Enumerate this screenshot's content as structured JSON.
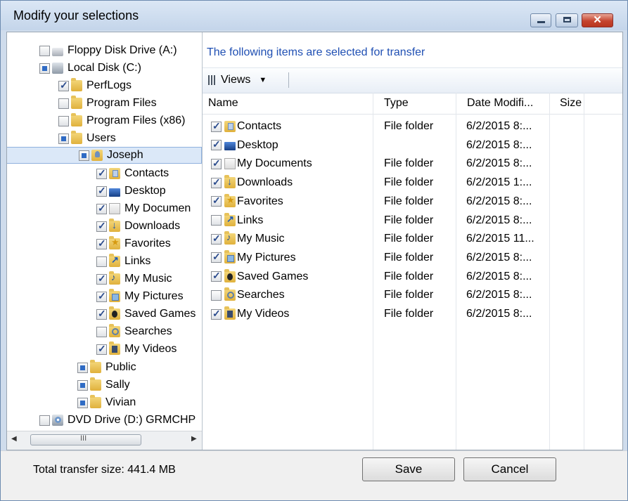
{
  "window": {
    "title": "Modify your selections",
    "close_glyph": "✕"
  },
  "tree": {
    "nodes": [
      {
        "label": "Floppy Disk Drive (A:)",
        "icon": "floppy-drive-icon",
        "check": "unchecked"
      },
      {
        "label": "Local Disk (C:)",
        "icon": "local-disk-icon",
        "check": "partial"
      },
      {
        "label": "PerfLogs",
        "icon": "folder-icon",
        "check": "checked"
      },
      {
        "label": "Program Files",
        "icon": "folder-icon",
        "check": "unchecked"
      },
      {
        "label": "Program Files (x86)",
        "icon": "folder-icon",
        "check": "unchecked"
      },
      {
        "label": "Users",
        "icon": "folder-icon",
        "check": "partial"
      },
      {
        "label": "Joseph",
        "icon": "user-folder-icon",
        "check": "partial",
        "selected": true
      },
      {
        "label": "Contacts",
        "icon": "contacts-folder-icon",
        "check": "checked"
      },
      {
        "label": "Desktop",
        "icon": "desktop-icon",
        "check": "checked"
      },
      {
        "label": "My Documen",
        "icon": "documents-folder-icon",
        "check": "checked"
      },
      {
        "label": "Downloads",
        "icon": "downloads-folder-icon",
        "check": "checked"
      },
      {
        "label": "Favorites",
        "icon": "favorites-folder-icon",
        "check": "checked"
      },
      {
        "label": "Links",
        "icon": "links-folder-icon",
        "check": "unchecked"
      },
      {
        "label": "My Music",
        "icon": "music-folder-icon",
        "check": "checked"
      },
      {
        "label": "My Pictures",
        "icon": "pictures-folder-icon",
        "check": "checked"
      },
      {
        "label": "Saved Games",
        "icon": "saved-games-folder-icon",
        "check": "checked"
      },
      {
        "label": "Searches",
        "icon": "searches-folder-icon",
        "check": "unchecked"
      },
      {
        "label": "My Videos",
        "icon": "videos-folder-icon",
        "check": "checked"
      },
      {
        "label": "Public",
        "icon": "folder-icon",
        "check": "partial"
      },
      {
        "label": "Sally",
        "icon": "folder-icon",
        "check": "partial"
      },
      {
        "label": "Vivian",
        "icon": "folder-icon",
        "check": "partial"
      },
      {
        "label": "DVD Drive (D:) GRMCHP",
        "icon": "dvd-drive-icon",
        "check": "unchecked"
      }
    ],
    "scroll_grip": "III",
    "scroll_left": "◀",
    "scroll_right": "▶"
  },
  "right": {
    "heading": "The following items are selected for transfer",
    "views_label": "Views",
    "views_arrow": "▼",
    "columns": [
      "Name",
      "Type",
      "Date Modifi...",
      "Size"
    ],
    "rows": [
      {
        "checked": true,
        "icon": "contacts-folder-icon",
        "name": "Contacts",
        "type": "File folder",
        "date": "6/2/2015 8:...",
        "size": ""
      },
      {
        "checked": true,
        "icon": "desktop-icon",
        "name": "Desktop",
        "type": "",
        "date": "6/2/2015 8:...",
        "size": ""
      },
      {
        "checked": true,
        "icon": "documents-folder-icon",
        "name": "My Documents",
        "type": "File folder",
        "date": "6/2/2015 8:...",
        "size": ""
      },
      {
        "checked": true,
        "icon": "downloads-folder-icon",
        "name": "Downloads",
        "type": "File folder",
        "date": "6/2/2015 1:...",
        "size": ""
      },
      {
        "checked": true,
        "icon": "favorites-folder-icon",
        "name": "Favorites",
        "type": "File folder",
        "date": "6/2/2015 8:...",
        "size": ""
      },
      {
        "checked": false,
        "icon": "links-folder-icon",
        "name": "Links",
        "type": "File folder",
        "date": "6/2/2015 8:...",
        "size": ""
      },
      {
        "checked": true,
        "icon": "music-folder-icon",
        "name": "My Music",
        "type": "File folder",
        "date": "6/2/2015 11...",
        "size": ""
      },
      {
        "checked": true,
        "icon": "pictures-folder-icon",
        "name": "My Pictures",
        "type": "File folder",
        "date": "6/2/2015 8:...",
        "size": ""
      },
      {
        "checked": true,
        "icon": "saved-games-folder-icon",
        "name": "Saved Games",
        "type": "File folder",
        "date": "6/2/2015 8:...",
        "size": ""
      },
      {
        "checked": false,
        "icon": "searches-folder-icon",
        "name": "Searches",
        "type": "File folder",
        "date": "6/2/2015 8:...",
        "size": ""
      },
      {
        "checked": true,
        "icon": "videos-folder-icon",
        "name": "My Videos",
        "type": "File folder",
        "date": "6/2/2015 8:...",
        "size": ""
      }
    ]
  },
  "footer": {
    "total": "Total transfer size: 441.4 MB",
    "save": "Save",
    "cancel": "Cancel"
  }
}
